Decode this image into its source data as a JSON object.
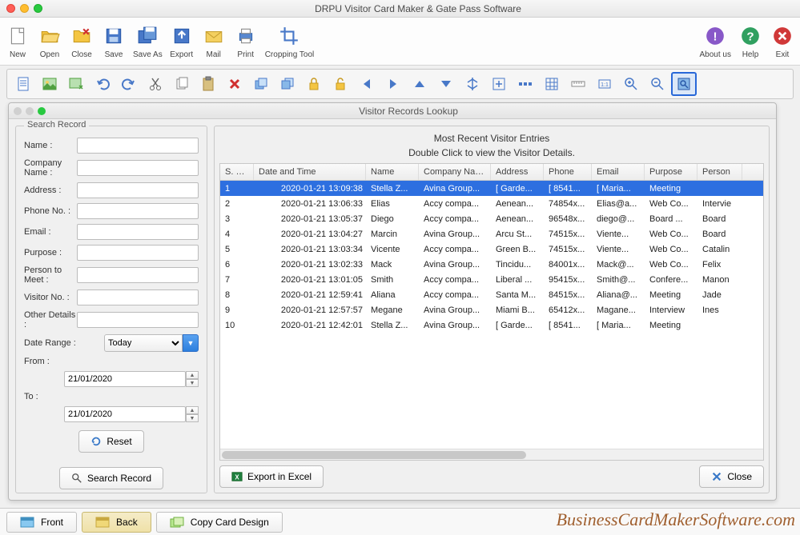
{
  "app": {
    "title": "DRPU Visitor Card Maker & Gate Pass Software"
  },
  "main_toolbar": {
    "left": [
      {
        "name": "new",
        "label": "New"
      },
      {
        "name": "open",
        "label": "Open"
      },
      {
        "name": "close",
        "label": "Close"
      },
      {
        "name": "save",
        "label": "Save"
      },
      {
        "name": "save-as",
        "label": "Save As"
      },
      {
        "name": "export",
        "label": "Export"
      },
      {
        "name": "mail",
        "label": "Mail"
      },
      {
        "name": "print",
        "label": "Print"
      },
      {
        "name": "cropping-tool",
        "label": "Cropping Tool"
      }
    ],
    "right": [
      {
        "name": "about",
        "label": "About us"
      },
      {
        "name": "help",
        "label": "Help"
      },
      {
        "name": "exit",
        "label": "Exit"
      }
    ]
  },
  "subwin": {
    "title": "Visitor Records Lookup"
  },
  "search": {
    "legend": "Search Record",
    "fields": {
      "name": "Name :",
      "company": "Company Name :",
      "address": "Address :",
      "phone": "Phone No. :",
      "email": "Email :",
      "purpose": "Purpose :",
      "person": "Person to Meet :",
      "visitor_no": "Visitor No. :",
      "other": "Other Details :",
      "date_range": "Date Range :",
      "from": "From :",
      "to": "To :"
    },
    "date_range_value": "Today",
    "from_value": "21/01/2020",
    "to_value": "21/01/2020",
    "reset": "Reset",
    "search_btn": "Search Record"
  },
  "table": {
    "title1": "Most Recent Visitor Entries",
    "title2": "Double Click to view the Visitor Details.",
    "headers": [
      "S. No.",
      "Date and Time",
      "Name",
      "Company Name",
      "Address",
      "Phone",
      "Email",
      "Purpose",
      "Person"
    ],
    "rows": [
      {
        "sno": "1",
        "dt": "2020-01-21 13:09:38",
        "name": "Stella Z...",
        "comp": "Avina Group...",
        "addr": "[ Garde...",
        "phone": "[ 8541...",
        "email": "[ Maria...",
        "purp": "Meeting",
        "pers": ""
      },
      {
        "sno": "2",
        "dt": "2020-01-21 13:06:33",
        "name": "Elias",
        "comp": "Accy compa...",
        "addr": "Aenean...",
        "phone": "74854x...",
        "email": "Elias@a...",
        "purp": "Web Co...",
        "pers": "Intervie"
      },
      {
        "sno": "3",
        "dt": "2020-01-21 13:05:37",
        "name": "Diego",
        "comp": "Accy compa...",
        "addr": "Aenean...",
        "phone": "96548x...",
        "email": "diego@...",
        "purp": "Board ...",
        "pers": "Board "
      },
      {
        "sno": "4",
        "dt": "2020-01-21 13:04:27",
        "name": "Marcin",
        "comp": "Avina Group...",
        "addr": "Arcu St...",
        "phone": "74515x...",
        "email": "Viente...",
        "purp": "Web Co...",
        "pers": "Board "
      },
      {
        "sno": "5",
        "dt": "2020-01-21 13:03:34",
        "name": "Vicente",
        "comp": "Accy compa...",
        "addr": "Green B...",
        "phone": "74515x...",
        "email": "Viente...",
        "purp": "Web Co...",
        "pers": "Catalin"
      },
      {
        "sno": "6",
        "dt": "2020-01-21 13:02:33",
        "name": "Mack",
        "comp": "Avina Group...",
        "addr": "Tincidu...",
        "phone": "84001x...",
        "email": "Mack@...",
        "purp": "Web Co...",
        "pers": "Felix"
      },
      {
        "sno": "7",
        "dt": "2020-01-21 13:01:05",
        "name": "Smith",
        "comp": "Accy compa...",
        "addr": "Liberal ...",
        "phone": "95415x...",
        "email": "Smith@...",
        "purp": "Confere...",
        "pers": "Manon"
      },
      {
        "sno": "8",
        "dt": "2020-01-21 12:59:41",
        "name": "Aliana",
        "comp": "Accy compa...",
        "addr": "Santa M...",
        "phone": "84515x...",
        "email": "Aliana@...",
        "purp": "Meeting",
        "pers": "Jade"
      },
      {
        "sno": "9",
        "dt": "2020-01-21 12:57:57",
        "name": "Megane",
        "comp": "Avina Group...",
        "addr": "Miami B...",
        "phone": "65412x...",
        "email": "Magane...",
        "purp": "Interview",
        "pers": "Ines"
      },
      {
        "sno": "10",
        "dt": "2020-01-21 12:42:01",
        "name": "Stella Z...",
        "comp": "Avina Group...",
        "addr": "[ Garde...",
        "phone": "[ 8541...",
        "email": "[ Maria...",
        "purp": "Meeting",
        "pers": ""
      }
    ],
    "export": "Export  in Excel",
    "close": "Close"
  },
  "bottom": {
    "front": "Front",
    "back": "Back",
    "copy": "Copy Card Design"
  },
  "watermark": "BusinessCardMakerSoftware.com"
}
